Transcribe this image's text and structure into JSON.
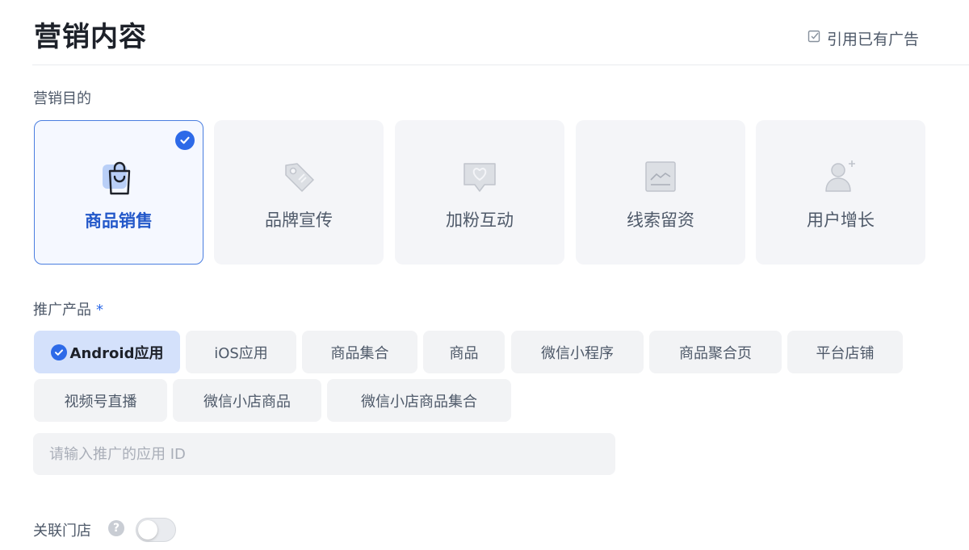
{
  "header": {
    "title": "营销内容",
    "reference_ad_label": "引用已有广告"
  },
  "marketing_goal": {
    "label": "营销目的",
    "options": [
      {
        "label": "商品销售",
        "icon": "shopping-bag-icon",
        "selected": true
      },
      {
        "label": "品牌宣传",
        "icon": "tag-icon",
        "selected": false
      },
      {
        "label": "加粉互动",
        "icon": "heart-message-icon",
        "selected": false
      },
      {
        "label": "线索留资",
        "icon": "image-frame-icon",
        "selected": false
      },
      {
        "label": "用户增长",
        "icon": "add-user-icon",
        "selected": false
      }
    ]
  },
  "promoted_product": {
    "label": "推广产品",
    "required_mark": "*",
    "options": [
      {
        "label": "Android应用",
        "selected": true
      },
      {
        "label": "iOS应用",
        "selected": false
      },
      {
        "label": "商品集合",
        "selected": false
      },
      {
        "label": "商品",
        "selected": false
      },
      {
        "label": "微信小程序",
        "selected": false
      },
      {
        "label": "商品聚合页",
        "selected": false
      },
      {
        "label": "平台店铺",
        "selected": false
      },
      {
        "label": "视频号直播",
        "selected": false
      },
      {
        "label": "微信小店商品",
        "selected": false
      },
      {
        "label": "微信小店商品集合",
        "selected": false
      }
    ],
    "app_id_value": "",
    "app_id_placeholder": "请输入推广的应用 ID"
  },
  "linked_store": {
    "label": "关联门店",
    "help_icon": "question-icon",
    "enabled": false
  },
  "colors": {
    "accent": "#2d6ae8",
    "selected_card_bg": "#f5f8ff",
    "selected_chip_bg": "#d4e1fb",
    "option_bg": "#f2f3f5"
  }
}
